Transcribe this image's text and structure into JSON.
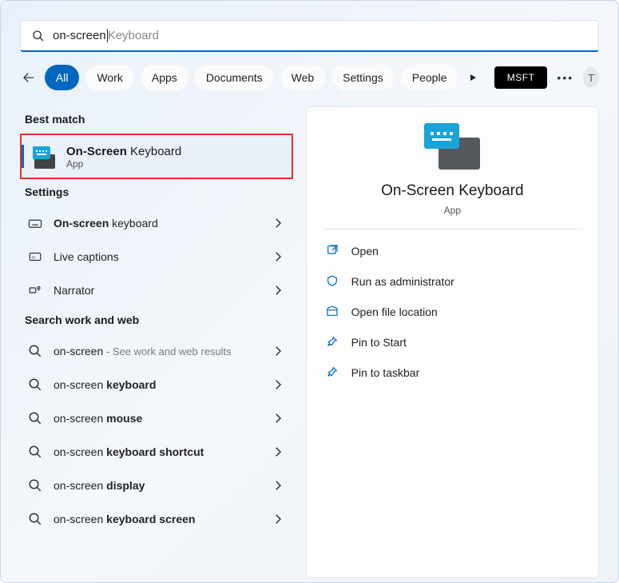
{
  "search": {
    "typed": "on-screen",
    "hint": "Keyboard"
  },
  "tabs": [
    "All",
    "Work",
    "Apps",
    "Documents",
    "Web",
    "Settings",
    "People"
  ],
  "active_tab": 0,
  "msft_label": "MSFT",
  "avatar_letter": "T",
  "sections": {
    "best_match_title": "Best match",
    "settings_title": "Settings",
    "search_web_title": "Search work and web"
  },
  "best_match": {
    "title_bold": "On-Screen",
    "title_light": " Keyboard",
    "subtitle": "App"
  },
  "settings_items": [
    {
      "prefix_bold": "On-screen",
      "rest": " keyboard",
      "icon": "keyboard"
    },
    {
      "prefix_bold": "",
      "rest": "Live captions",
      "icon": "captions"
    },
    {
      "prefix_bold": "",
      "rest": "Narrator",
      "icon": "narrator"
    }
  ],
  "web_items": [
    {
      "text": "on-screen",
      "suffix_bold": "",
      "hint": " - See work and web results"
    },
    {
      "text": "on-screen ",
      "suffix_bold": "keyboard",
      "hint": ""
    },
    {
      "text": "on-screen ",
      "suffix_bold": "mouse",
      "hint": ""
    },
    {
      "text": "on-screen ",
      "suffix_bold": "keyboard shortcut",
      "hint": ""
    },
    {
      "text": "on-screen ",
      "suffix_bold": "display",
      "hint": ""
    },
    {
      "text": "on-screen ",
      "suffix_bold": "keyboard screen",
      "hint": ""
    }
  ],
  "preview": {
    "title": "On-Screen Keyboard",
    "subtitle": "App",
    "actions": [
      "Open",
      "Run as administrator",
      "Open file location",
      "Pin to Start",
      "Pin to taskbar"
    ]
  }
}
